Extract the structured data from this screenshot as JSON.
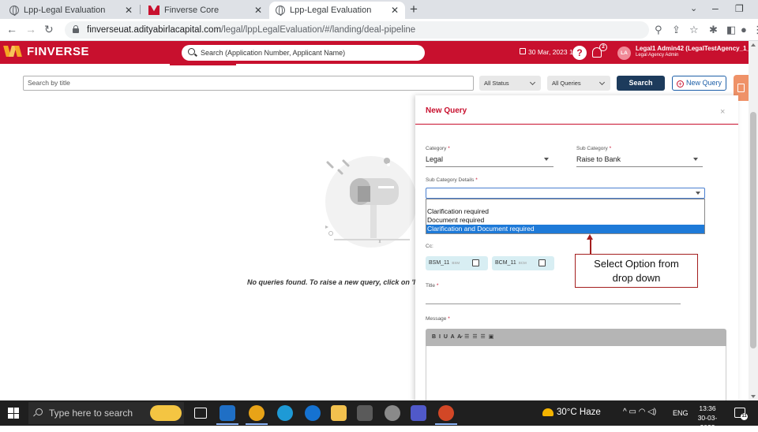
{
  "browser": {
    "tabs": [
      {
        "label": "Lpp-Legal Evaluation",
        "icon": "globe-icon",
        "active": false
      },
      {
        "label": "Finverse Core",
        "icon": "finverse-logo-icon",
        "active": false
      },
      {
        "label": "Lpp-Legal Evaluation",
        "icon": "globe-icon",
        "active": true
      }
    ],
    "new_tab": "+",
    "url_host": "finverseuat.adityabirlacapital.com",
    "url_path": "/legal/lppLegalEvaluation/#/landing/deal-pipeline"
  },
  "header": {
    "brand": "FINVERSE",
    "search_placeholder": "Search (Application Number, Applicant Name)",
    "datetime": "30 Mar, 2023 13:36",
    "notification_count": "2",
    "avatar_initials": "LA",
    "user_name": "Legal1 Admin42 (LegalTestAgency_1_4:",
    "user_role": "Legal Agency Admin",
    "accent_color": "#c8102e"
  },
  "toolbar": {
    "title_search_placeholder": "Search by title",
    "status_filter": "All Status",
    "queries_filter": "All Queries",
    "search_label": "Search",
    "new_query_label": "New Query"
  },
  "empty_state": {
    "message": "No queries found. To raise a new query, click on 'N"
  },
  "modal": {
    "title": "New Query",
    "close": "×",
    "category_label": "Category",
    "category_value": "Legal",
    "sub_category_label": "Sub Category",
    "sub_category_value": "Raise to Bank",
    "sub_category_details_label": "Sub Category Details",
    "sub_category_details_value": "",
    "dropdown_options": [
      {
        "label": "Clarification required",
        "selected": false
      },
      {
        "label": "Document required",
        "selected": false
      },
      {
        "label": "Clarification and Document required",
        "selected": true
      }
    ],
    "required_mark": "*",
    "cc_label": "Cc:",
    "cc_chips": [
      {
        "name": "BSM_11",
        "role": "BSM",
        "checked": false
      },
      {
        "name": "BCM_11",
        "role": "BCM",
        "checked": false
      }
    ],
    "title_label": "Title",
    "title_value": "",
    "message_label": "Message",
    "editor_tools": "B  I  U  A  A̷  ☰  ☰  ☰  ▣"
  },
  "annotation": {
    "line1": "Select Option from",
    "line2": "drop down",
    "color": "#a41e1e"
  },
  "taskbar": {
    "search_placeholder": "Type here to search",
    "weather": "30°C  Haze",
    "tray_icons": "^   ▭  ◠  ◁)",
    "language": "ENG",
    "time": "13:36",
    "date": "30-03-2023",
    "notification_count": "11"
  }
}
